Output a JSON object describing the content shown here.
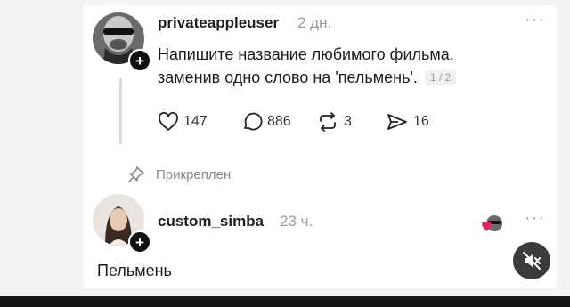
{
  "post": {
    "username": "privateappleuser",
    "time": "2 дн.",
    "lines": [
      "Напишите название любимого фильма,",
      "заменив одно слово на 'пельмень'."
    ],
    "pager": "1 / 2",
    "actions": {
      "likes": "147",
      "comments": "886",
      "reposts": "3",
      "shares": "16"
    },
    "more_icon": "more-dots-icon"
  },
  "pinned": {
    "label": "Прикреплен",
    "icon": "pin-icon"
  },
  "reply": {
    "username": "custom_simba",
    "time": "23 ч.",
    "text": "Пельмень",
    "more_icon": "more-dots-icon"
  },
  "overlay": {
    "icon": "mute-icon"
  },
  "colors": {
    "background": "#f3f3f3",
    "card": "#ffffff",
    "text": "#1d1d1d",
    "muted": "#9b9b9b",
    "bar": "#141414"
  }
}
